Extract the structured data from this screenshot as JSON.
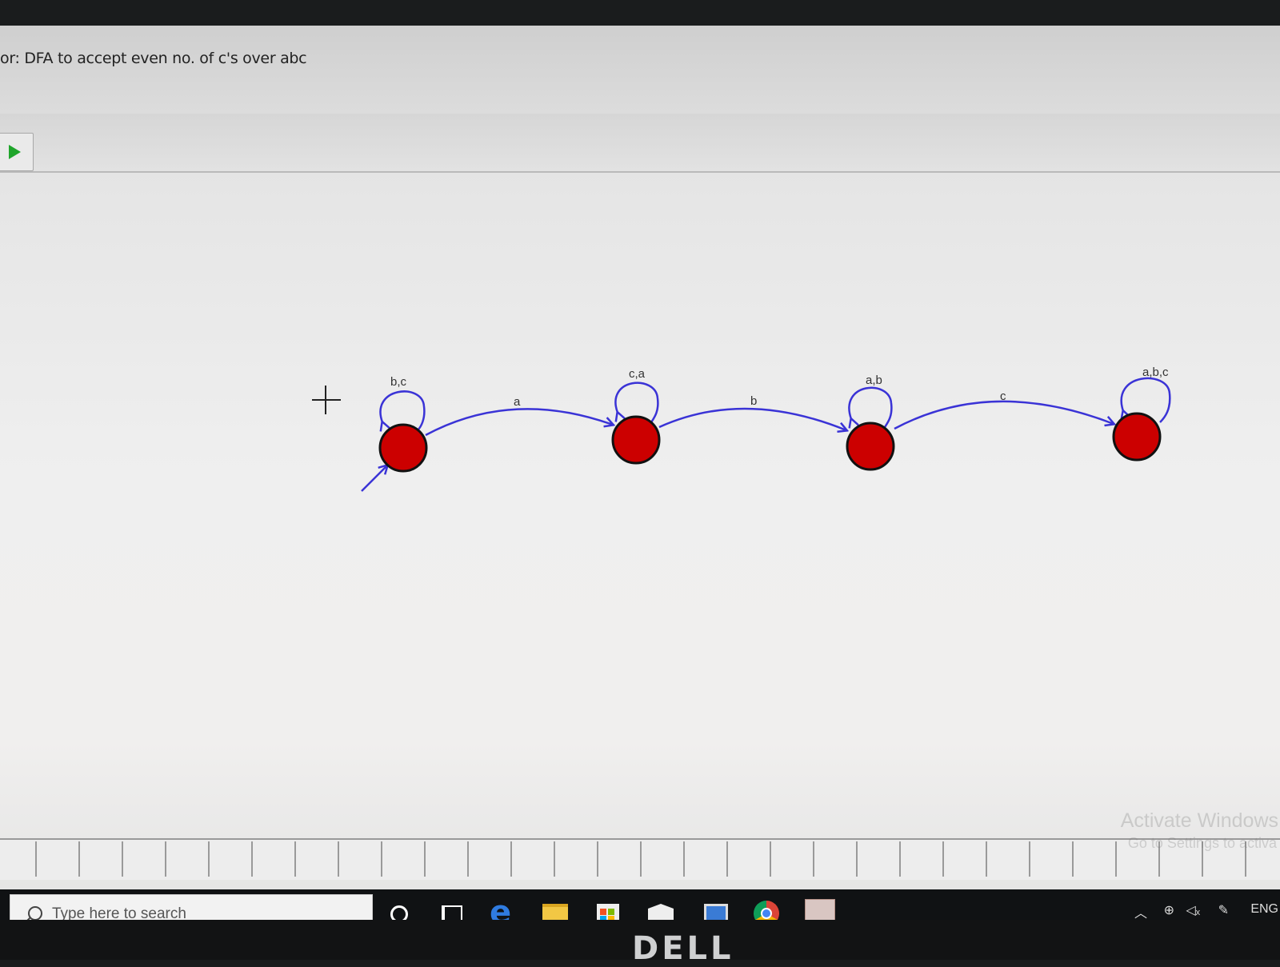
{
  "window": {
    "title": "or: DFA to accept even no. of c's over abc"
  },
  "toolbar": {
    "run_icon": "play-icon"
  },
  "diagram": {
    "states": [
      {
        "id": "q0",
        "initial": true
      },
      {
        "id": "q1",
        "initial": false
      },
      {
        "id": "q2",
        "initial": false
      },
      {
        "id": "q3",
        "initial": false
      }
    ],
    "transitions": [
      {
        "from": "q0",
        "to": "q0",
        "label": "b,c"
      },
      {
        "from": "q0",
        "to": "q1",
        "label": "a"
      },
      {
        "from": "q1",
        "to": "q1",
        "label": "c,a"
      },
      {
        "from": "q1",
        "to": "q2",
        "label": "b"
      },
      {
        "from": "q2",
        "to": "q2",
        "label": "a,b"
      },
      {
        "from": "q2",
        "to": "q3",
        "label": "c"
      },
      {
        "from": "q3",
        "to": "q3",
        "label": "a,b,c"
      }
    ],
    "state_color": "#cc0000",
    "edge_color": "#3a33d6"
  },
  "watermark": {
    "line1": "Activate Windows",
    "line2": "Go to Settings to activa"
  },
  "taskbar": {
    "search_placeholder": "Type here to search",
    "icons": [
      "cortana-icon",
      "task-view-icon",
      "edge-icon",
      "file-explorer-icon",
      "store-icon",
      "mail-icon",
      "app-icon",
      "chrome-icon",
      "jflap-icon"
    ],
    "tray": {
      "language": "ENG"
    }
  },
  "bezel": {
    "brand": "DELL"
  }
}
